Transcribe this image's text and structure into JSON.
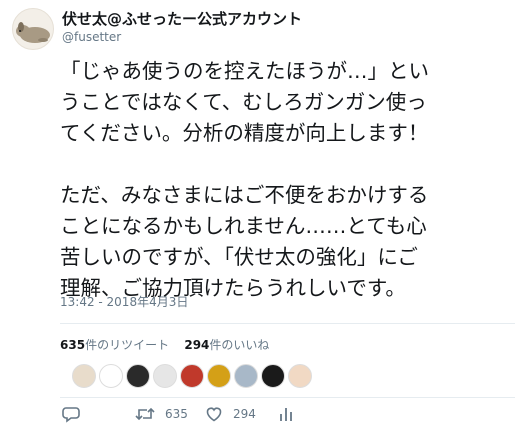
{
  "account": {
    "display_name": "伏せ太@ふせったー公式アカウント",
    "handle": "@fusetter",
    "avatar_icon": "dog-avatar-icon"
  },
  "tweet": {
    "lines": [
      "「じゃあ使うのを控えたほうが…」とい",
      "うことではなくて、むしろガンガン使っ",
      "てください。分析の精度が向上します！",
      "",
      "ただ、みなさまにはご不便をおかけする",
      "ことになるかもしれません……とても心",
      "苦しいのですが、「伏せ太の強化」にご",
      "理解、ご協力頂けたらうれしいです。"
    ],
    "timestamp": "13:42 - 2018年4月3日"
  },
  "stats": {
    "retweets_count": "635",
    "retweets_label": "件のリツイート",
    "likes_count": "294",
    "likes_label": "件のいいね"
  },
  "likers": [
    {
      "color": "#e8dccb"
    },
    {
      "color": "#ffffff"
    },
    {
      "color": "#2a2a2a"
    },
    {
      "color": "#e6e6e6"
    },
    {
      "color": "#c0392b"
    },
    {
      "color": "#d4a017"
    },
    {
      "color": "#a8b8c8"
    },
    {
      "color": "#1a1a1a"
    },
    {
      "color": "#f1d9c4"
    }
  ],
  "actions": {
    "reply_icon": "reply-icon",
    "retweet_icon": "retweet-icon",
    "retweet_count": "635",
    "like_icon": "heart-icon",
    "like_count": "294",
    "analytics_icon": "analytics-icon"
  },
  "colors": {
    "text": "#14171a",
    "secondary": "#657786",
    "divider": "#e6ecf0"
  }
}
